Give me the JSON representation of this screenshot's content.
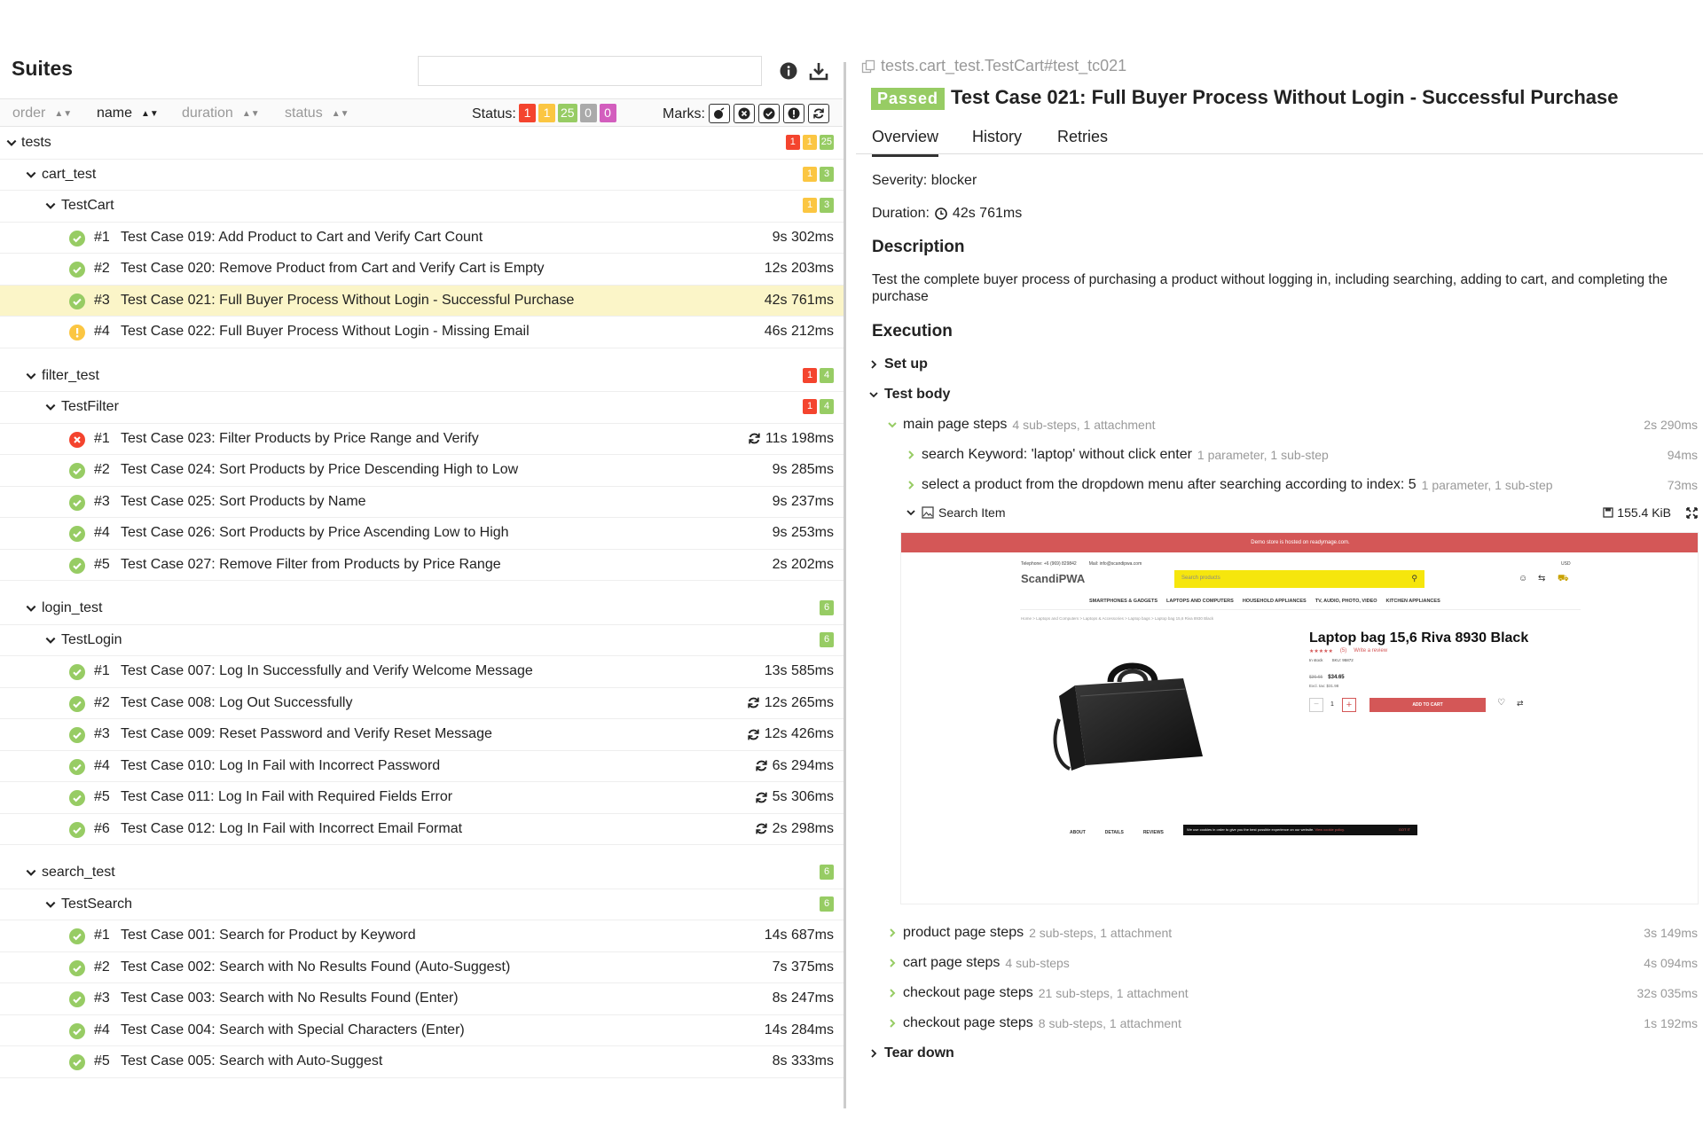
{
  "suites": {
    "title": "Suites",
    "search_placeholder": "",
    "sort": {
      "order": "order",
      "name": "name",
      "duration": "duration",
      "status": "status"
    },
    "status_label": "Status:",
    "status_counts": {
      "failed": "1",
      "broken": "1",
      "passed": "25",
      "skipped": "0",
      "unknown": "0"
    },
    "marks_label": "Marks:",
    "root": {
      "name": "tests",
      "badges": [
        "1",
        "1",
        "25"
      ]
    },
    "groups": [
      {
        "name": "cart_test",
        "badges": [
          {
            "c": "yel",
            "v": "1"
          },
          {
            "c": "grn",
            "v": "3"
          }
        ],
        "class": {
          "name": "TestCart",
          "badges": [
            {
              "c": "yel",
              "v": "1"
            },
            {
              "c": "grn",
              "v": "3"
            }
          ]
        },
        "tests": [
          {
            "status": "passed",
            "num": "#1",
            "title": "Test Case 019: Add Product to Cart and Verify Cart Count",
            "duration": "9s 302ms",
            "retry": false
          },
          {
            "status": "passed",
            "num": "#2",
            "title": "Test Case 020: Remove Product from Cart and Verify Cart is Empty",
            "duration": "12s 203ms",
            "retry": false
          },
          {
            "status": "passed",
            "num": "#3",
            "title": "Test Case 021: Full Buyer Process Without Login - Successful Purchase",
            "duration": "42s 761ms",
            "retry": false,
            "selected": true
          },
          {
            "status": "broken",
            "num": "#4",
            "title": "Test Case 022: Full Buyer Process Without Login - Missing Email",
            "duration": "46s 212ms",
            "retry": false
          }
        ]
      },
      {
        "name": "filter_test",
        "badges": [
          {
            "c": "red",
            "v": "1"
          },
          {
            "c": "grn",
            "v": "4"
          }
        ],
        "class": {
          "name": "TestFilter",
          "badges": [
            {
              "c": "red",
              "v": "1"
            },
            {
              "c": "grn",
              "v": "4"
            }
          ]
        },
        "tests": [
          {
            "status": "failed",
            "num": "#1",
            "title": "Test Case 023: Filter Products by Price Range and Verify",
            "duration": "11s 198ms",
            "retry": true
          },
          {
            "status": "passed",
            "num": "#2",
            "title": "Test Case 024: Sort Products by Price Descending High to Low",
            "duration": "9s 285ms",
            "retry": false
          },
          {
            "status": "passed",
            "num": "#3",
            "title": "Test Case 025: Sort Products by Name",
            "duration": "9s 237ms",
            "retry": false
          },
          {
            "status": "passed",
            "num": "#4",
            "title": "Test Case 026: Sort Products by Price Ascending Low to High",
            "duration": "9s 253ms",
            "retry": false
          },
          {
            "status": "passed",
            "num": "#5",
            "title": "Test Case 027: Remove Filter from Products by Price Range",
            "duration": "2s 202ms",
            "retry": false
          }
        ]
      },
      {
        "name": "login_test",
        "badges": [
          {
            "c": "grn",
            "v": "6"
          }
        ],
        "class": {
          "name": "TestLogin",
          "badges": [
            {
              "c": "grn",
              "v": "6"
            }
          ]
        },
        "tests": [
          {
            "status": "passed",
            "num": "#1",
            "title": "Test Case 007: Log In Successfully and Verify Welcome Message",
            "duration": "13s 585ms",
            "retry": false
          },
          {
            "status": "passed",
            "num": "#2",
            "title": "Test Case 008: Log Out Successfully",
            "duration": "12s 265ms",
            "retry": true
          },
          {
            "status": "passed",
            "num": "#3",
            "title": "Test Case 009: Reset Password and Verify Reset Message",
            "duration": "12s 426ms",
            "retry": true
          },
          {
            "status": "passed",
            "num": "#4",
            "title": "Test Case 010: Log In Fail with Incorrect Password",
            "duration": "6s 294ms",
            "retry": true
          },
          {
            "status": "passed",
            "num": "#5",
            "title": "Test Case 011: Log In Fail with Required Fields Error",
            "duration": "5s 306ms",
            "retry": true
          },
          {
            "status": "passed",
            "num": "#6",
            "title": "Test Case 012: Log In Fail with Incorrect Email Format",
            "duration": "2s 298ms",
            "retry": true
          }
        ]
      },
      {
        "name": "search_test",
        "badges": [
          {
            "c": "grn",
            "v": "6"
          }
        ],
        "class": {
          "name": "TestSearch",
          "badges": [
            {
              "c": "grn",
              "v": "6"
            }
          ]
        },
        "tests": [
          {
            "status": "passed",
            "num": "#1",
            "title": "Test Case 001: Search for Product by Keyword",
            "duration": "14s 687ms",
            "retry": false
          },
          {
            "status": "passed",
            "num": "#2",
            "title": "Test Case 002: Search with No Results Found (Auto-Suggest)",
            "duration": "7s 375ms",
            "retry": false
          },
          {
            "status": "passed",
            "num": "#3",
            "title": "Test Case 003: Search with No Results Found (Enter)",
            "duration": "8s 247ms",
            "retry": false
          },
          {
            "status": "passed",
            "num": "#4",
            "title": "Test Case 004: Search with Special Characters (Enter)",
            "duration": "14s 284ms",
            "retry": false
          },
          {
            "status": "passed",
            "num": "#5",
            "title": "Test Case 005: Search with Auto-Suggest",
            "duration": "8s 333ms",
            "retry": false
          }
        ]
      }
    ]
  },
  "detail": {
    "breadcrumb": "tests.cart_test.TestCart#test_tc021",
    "status": "Passed",
    "title": "Test Case 021: Full Buyer Process Without Login - Successful Purchase",
    "tabs": [
      "Overview",
      "History",
      "Retries"
    ],
    "severity": "Severity: blocker",
    "duration_label": "Duration:",
    "duration": "42s 761ms",
    "description_heading": "Description",
    "description": "Test the complete buyer process of purchasing a product without logging in, including searching, adding to cart, and completing the purchase",
    "execution_heading": "Execution",
    "setup": "Set up",
    "test_body": "Test body",
    "teardown": "Tear down",
    "main_step": {
      "name": "main page steps",
      "meta": "4 sub-steps, 1 attachment",
      "duration": "2s 290ms"
    },
    "sub_steps": [
      {
        "name": "search Keyword: 'laptop' without click enter",
        "meta": "1 parameter, 1 sub-step",
        "duration": "94ms"
      },
      {
        "name": "select a product from the dropdown menu after searching according to index: 5",
        "meta": "1 parameter, 1 sub-step",
        "duration": "73ms"
      }
    ],
    "attachment": {
      "name": "Search Item",
      "size": "155.4 KiB"
    },
    "other_steps": [
      {
        "name": "product page steps",
        "meta": "2 sub-steps, 1 attachment",
        "duration": "3s 149ms"
      },
      {
        "name": "cart page steps",
        "meta": "4 sub-steps",
        "duration": "4s 094ms"
      },
      {
        "name": "checkout page steps",
        "meta": "21 sub-steps, 1 attachment",
        "duration": "32s 035ms"
      },
      {
        "name": "checkout page steps",
        "meta": "8 sub-steps, 1 attachment",
        "duration": "1s 192ms"
      }
    ],
    "screenshot": {
      "banner": "Demo store is hosted on readymage.com.",
      "telephone": "Telephone: +6 (969) 829842",
      "mail": "Mail: info@scandipwa.com",
      "currency": "USD",
      "logo": "ScandiPWA",
      "search_placeholder": "Search products",
      "nav": [
        "SMARTPHONES & GADGETS",
        "LAPTOPS AND COMPUTERS",
        "HOUSEHOLD APPLIANCES",
        "TV, AUDIO, PHOTO, VIDEO",
        "KITCHEN APPLIANCES"
      ],
      "breadcrumbs": "Home  >  Laptops and Computers  >  Laptops & Accessories  >  Laptop bags  >  Laptop bag 15,6 Riva 8930 Black",
      "product_name": "Laptop bag 15,6 Riva 8930 Black",
      "rating_count": "(5)",
      "write_review": "Write a review",
      "stock": "In stock",
      "sku": "SKU: 95872",
      "old_price": "$36.65",
      "price": "$34.65",
      "excl_tax": "Excl. tax: $31.98",
      "qty": "1",
      "add_to_cart": "ADD TO CART",
      "tabs": [
        "ABOUT",
        "DETAILS",
        "REVIEWS"
      ],
      "cookie": "We use cookies in order to give you the best possible experience on our website.",
      "cookie_link": "View cookie policy.",
      "cookie_btn": "GOT IT"
    }
  },
  "colors": {
    "passed": "#97cc64",
    "failed": "#f4442e",
    "broken": "#fbc642",
    "skipped": "#aaaaaa",
    "unknown": "#d35ebe",
    "selected_row": "#fbf5c8"
  }
}
